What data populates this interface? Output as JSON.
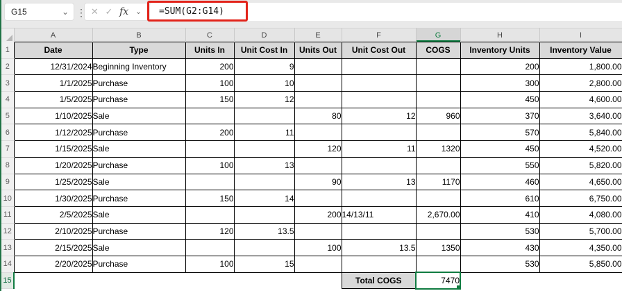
{
  "app": {
    "name_box": "G15",
    "formula": "=SUM(G2:G14)",
    "icons": {
      "cancel": "✕",
      "enter": "✓",
      "insert_function": "fx",
      "chevron_down": "⌄",
      "separator_dots": "⋮"
    }
  },
  "colors": {
    "excel_green": "#107C41",
    "window_green": "#217346",
    "annotation_red": "#E2231A",
    "table_header_fill": "#D9D9D9",
    "chrome_bg": "#E9E9E9"
  },
  "selected_column": "G",
  "selected_row": "15",
  "column_headers": [
    "A",
    "B",
    "C",
    "D",
    "E",
    "F",
    "G",
    "H",
    "I"
  ],
  "row_numbers": [
    "1",
    "2",
    "3",
    "4",
    "5",
    "6",
    "7",
    "8",
    "9",
    "10",
    "11",
    "12",
    "13",
    "14",
    "15"
  ],
  "sheet": {
    "headers": [
      "Date",
      "Type",
      "Units In",
      "Unit Cost In",
      "Units Out",
      "Unit Cost Out",
      "COGS",
      "Inventory Units",
      "Inventory Value"
    ],
    "rows": [
      [
        "12/31/2024",
        "Beginning Inventory",
        "200",
        "9",
        "",
        "",
        "",
        "200",
        "1,800.00"
      ],
      [
        "1/1/2025",
        "Purchase",
        "100",
        "10",
        "",
        "",
        "",
        "300",
        "2,800.00"
      ],
      [
        "1/5/2025",
        "Purchase",
        "150",
        "12",
        "",
        "",
        "",
        "450",
        "4,600.00"
      ],
      [
        "1/10/2025",
        "Sale",
        "",
        "",
        "80",
        "12",
        "960",
        "370",
        "3,640.00"
      ],
      [
        "1/12/2025",
        "Purchase",
        "200",
        "11",
        "",
        "",
        "",
        "570",
        "5,840.00"
      ],
      [
        "1/15/2025",
        "Sale",
        "",
        "",
        "120",
        "11",
        "1320",
        "450",
        "4,520.00"
      ],
      [
        "1/20/2025",
        "Purchase",
        "100",
        "13",
        "",
        "",
        "",
        "550",
        "5,820.00"
      ],
      [
        "1/25/2025",
        "Sale",
        "",
        "",
        "90",
        "13",
        "1170",
        "460",
        "4,650.00"
      ],
      [
        "1/30/2025",
        "Purchase",
        "150",
        "14",
        "",
        "",
        "",
        "610",
        "6,750.00"
      ],
      [
        "2/5/2025",
        "Sale",
        "",
        "",
        "200",
        "14/13/11",
        "2,670.00",
        "410",
        "4,080.00"
      ],
      [
        "2/10/2025",
        "Purchase",
        "120",
        "13.5",
        "",
        "",
        "",
        "530",
        "5,700.00"
      ],
      [
        "2/15/2025",
        "Sale",
        "",
        "",
        "100",
        "13.5",
        "1350",
        "430",
        "4,350.00"
      ],
      [
        "2/20/2025",
        "Purchase",
        "100",
        "15",
        "",
        "",
        "",
        "530",
        "5,850.00"
      ]
    ],
    "total_label": "Total COGS",
    "total_value": "7470"
  }
}
